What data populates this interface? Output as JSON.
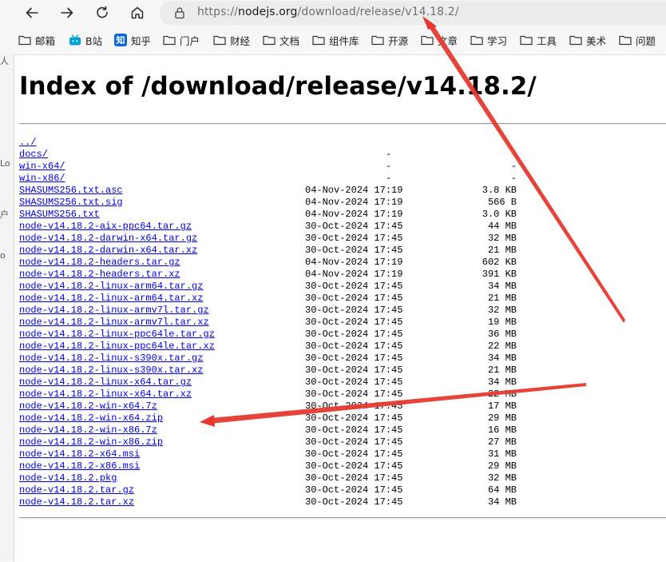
{
  "browser": {
    "url_scheme": "https://",
    "url_host": "nodejs.org",
    "url_path": "/download/release/v14.18.2/",
    "nav_icons": [
      "back-icon",
      "forward-icon",
      "reload-icon",
      "home-icon",
      "lock-icon"
    ]
  },
  "bookmarks": [
    {
      "label": "邮箱",
      "icon": "folder-icon"
    },
    {
      "label": "B站",
      "icon": "bilibili-icon"
    },
    {
      "label": "知乎",
      "icon": "zhihu-icon"
    },
    {
      "label": "门户",
      "icon": "folder-icon"
    },
    {
      "label": "财经",
      "icon": "folder-icon"
    },
    {
      "label": "文档",
      "icon": "folder-icon"
    },
    {
      "label": "组件库",
      "icon": "folder-icon"
    },
    {
      "label": "开源",
      "icon": "folder-icon"
    },
    {
      "label": "文章",
      "icon": "folder-icon"
    },
    {
      "label": "学习",
      "icon": "folder-icon"
    },
    {
      "label": "工具",
      "icon": "folder-icon"
    },
    {
      "label": "美术",
      "icon": "folder-icon"
    },
    {
      "label": "问题",
      "icon": "folder-icon"
    }
  ],
  "side_fragments": [
    "人",
    "Lo",
    "户",
    "o"
  ],
  "page": {
    "title": "Index of /download/release/v14.18.2/",
    "files": [
      {
        "name": "../",
        "date": "",
        "size": ""
      },
      {
        "name": "docs/",
        "date": "-",
        "size": "-"
      },
      {
        "name": "win-x64/",
        "date": "-",
        "size": "-"
      },
      {
        "name": "win-x86/",
        "date": "-",
        "size": "-"
      },
      {
        "name": "SHASUMS256.txt.asc",
        "date": "04-Nov-2024 17:19",
        "size": "3.8 KB"
      },
      {
        "name": "SHASUMS256.txt.sig",
        "date": "04-Nov-2024 17:19",
        "size": "566 B"
      },
      {
        "name": "SHASUMS256.txt",
        "date": "04-Nov-2024 17:19",
        "size": "3.0 KB"
      },
      {
        "name": "node-v14.18.2-aix-ppc64.tar.gz",
        "date": "30-Oct-2024 17:45",
        "size": "44 MB"
      },
      {
        "name": "node-v14.18.2-darwin-x64.tar.gz",
        "date": "30-Oct-2024 17:45",
        "size": "32 MB"
      },
      {
        "name": "node-v14.18.2-darwin-x64.tar.xz",
        "date": "30-Oct-2024 17:45",
        "size": "21 MB"
      },
      {
        "name": "node-v14.18.2-headers.tar.gz",
        "date": "04-Nov-2024 17:19",
        "size": "602 KB"
      },
      {
        "name": "node-v14.18.2-headers.tar.xz",
        "date": "04-Nov-2024 17:19",
        "size": "391 KB"
      },
      {
        "name": "node-v14.18.2-linux-arm64.tar.gz",
        "date": "30-Oct-2024 17:45",
        "size": "34 MB"
      },
      {
        "name": "node-v14.18.2-linux-arm64.tar.xz",
        "date": "30-Oct-2024 17:45",
        "size": "21 MB"
      },
      {
        "name": "node-v14.18.2-linux-armv7l.tar.gz",
        "date": "30-Oct-2024 17:45",
        "size": "32 MB"
      },
      {
        "name": "node-v14.18.2-linux-armv7l.tar.xz",
        "date": "30-Oct-2024 17:45",
        "size": "19 MB"
      },
      {
        "name": "node-v14.18.2-linux-ppc64le.tar.gz",
        "date": "30-Oct-2024 17:45",
        "size": "36 MB"
      },
      {
        "name": "node-v14.18.2-linux-ppc64le.tar.xz",
        "date": "30-Oct-2024 17:45",
        "size": "22 MB"
      },
      {
        "name": "node-v14.18.2-linux-s390x.tar.gz",
        "date": "30-Oct-2024 17:45",
        "size": "34 MB"
      },
      {
        "name": "node-v14.18.2-linux-s390x.tar.xz",
        "date": "30-Oct-2024 17:45",
        "size": "21 MB"
      },
      {
        "name": "node-v14.18.2-linux-x64.tar.gz",
        "date": "30-Oct-2024 17:45",
        "size": "34 MB"
      },
      {
        "name": "node-v14.18.2-linux-x64.tar.xz",
        "date": "30-Oct-2024 17:45",
        "size": "22 MB"
      },
      {
        "name": "node-v14.18.2-win-x64.7z",
        "date": "30-Oct-2024 17:45",
        "size": "17 MB"
      },
      {
        "name": "node-v14.18.2-win-x64.zip",
        "date": "30-Oct-2024 17:45",
        "size": "29 MB"
      },
      {
        "name": "node-v14.18.2-win-x86.7z",
        "date": "30-Oct-2024 17:45",
        "size": "16 MB"
      },
      {
        "name": "node-v14.18.2-win-x86.zip",
        "date": "30-Oct-2024 17:45",
        "size": "27 MB"
      },
      {
        "name": "node-v14.18.2-x64.msi",
        "date": "30-Oct-2024 17:45",
        "size": "31 MB"
      },
      {
        "name": "node-v14.18.2-x86.msi",
        "date": "30-Oct-2024 17:45",
        "size": "29 MB"
      },
      {
        "name": "node-v14.18.2.pkg",
        "date": "30-Oct-2024 17:45",
        "size": "32 MB"
      },
      {
        "name": "node-v14.18.2.tar.gz",
        "date": "30-Oct-2024 17:45",
        "size": "64 MB"
      },
      {
        "name": "node-v14.18.2.tar.xz",
        "date": "30-Oct-2024 17:45",
        "size": "34 MB"
      }
    ]
  },
  "annotations": {
    "arrow_color": "#e53a2f",
    "arrows": [
      "arrow-to-version",
      "arrow-to-win-x64-zip"
    ]
  },
  "colors": {
    "link": "#0000ee",
    "toolbar_bg": "#f7f7f7",
    "addressbar_bg": "#ececec"
  }
}
